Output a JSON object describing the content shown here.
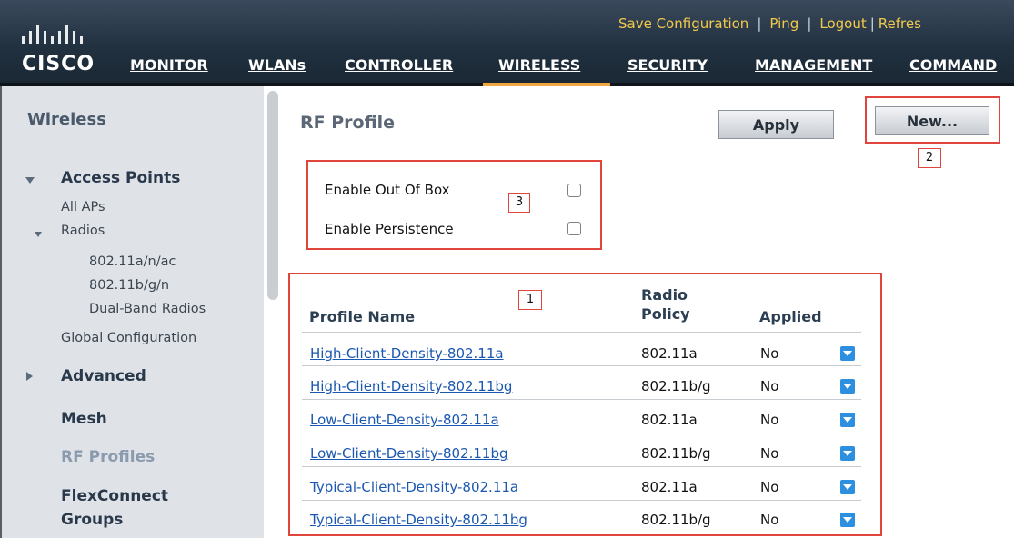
{
  "header": {
    "brand": "CISCO",
    "utility_links": [
      "Save Configuration",
      "Ping",
      "Logout",
      "Refres"
    ],
    "nav": [
      "MONITOR",
      "WLANs",
      "CONTROLLER",
      "WIRELESS",
      "SECURITY",
      "MANAGEMENT",
      "COMMAND"
    ],
    "active_nav": "WIRELESS",
    "active_color": "#f0a640"
  },
  "sidebar": {
    "title": "Wireless",
    "access_points": "Access Points",
    "all_aps": "All APs",
    "radios": "Radios",
    "radio_items": [
      "802.11a/n/ac",
      "802.11b/g/n",
      "Dual-Band Radios"
    ],
    "global_config": "Global Configuration",
    "advanced": "Advanced",
    "mesh": "Mesh",
    "rf_profiles": "RF Profiles",
    "flexconnect_1": "FlexConnect",
    "flexconnect_2": "Groups"
  },
  "main": {
    "title": "RF Profile",
    "apply_label": "Apply",
    "new_label": "New...",
    "options": {
      "out_of_box": "Enable Out Of Box",
      "persistence": "Enable Persistence"
    },
    "callouts": [
      "1",
      "2",
      "3"
    ],
    "table": {
      "headers": {
        "name": "Profile Name",
        "radio_1": "Radio",
        "radio_2": "Policy",
        "applied": "Applied"
      },
      "rows": [
        {
          "name": "High-Client-Density-802.11a",
          "policy": "802.11a",
          "applied": "No"
        },
        {
          "name": "High-Client-Density-802.11bg",
          "policy": "802.11b/g",
          "applied": "No"
        },
        {
          "name": "Low-Client-Density-802.11a",
          "policy": "802.11a",
          "applied": "No"
        },
        {
          "name": "Low-Client-Density-802.11bg",
          "policy": "802.11b/g",
          "applied": "No"
        },
        {
          "name": "Typical-Client-Density-802.11a",
          "policy": "802.11a",
          "applied": "No"
        },
        {
          "name": "Typical-Client-Density-802.11bg",
          "policy": "802.11b/g",
          "applied": "No"
        }
      ]
    }
  },
  "colors": {
    "highlight_box": "#e0453b",
    "link": "#1a57b0",
    "dropdown": "#2c8fe0"
  }
}
